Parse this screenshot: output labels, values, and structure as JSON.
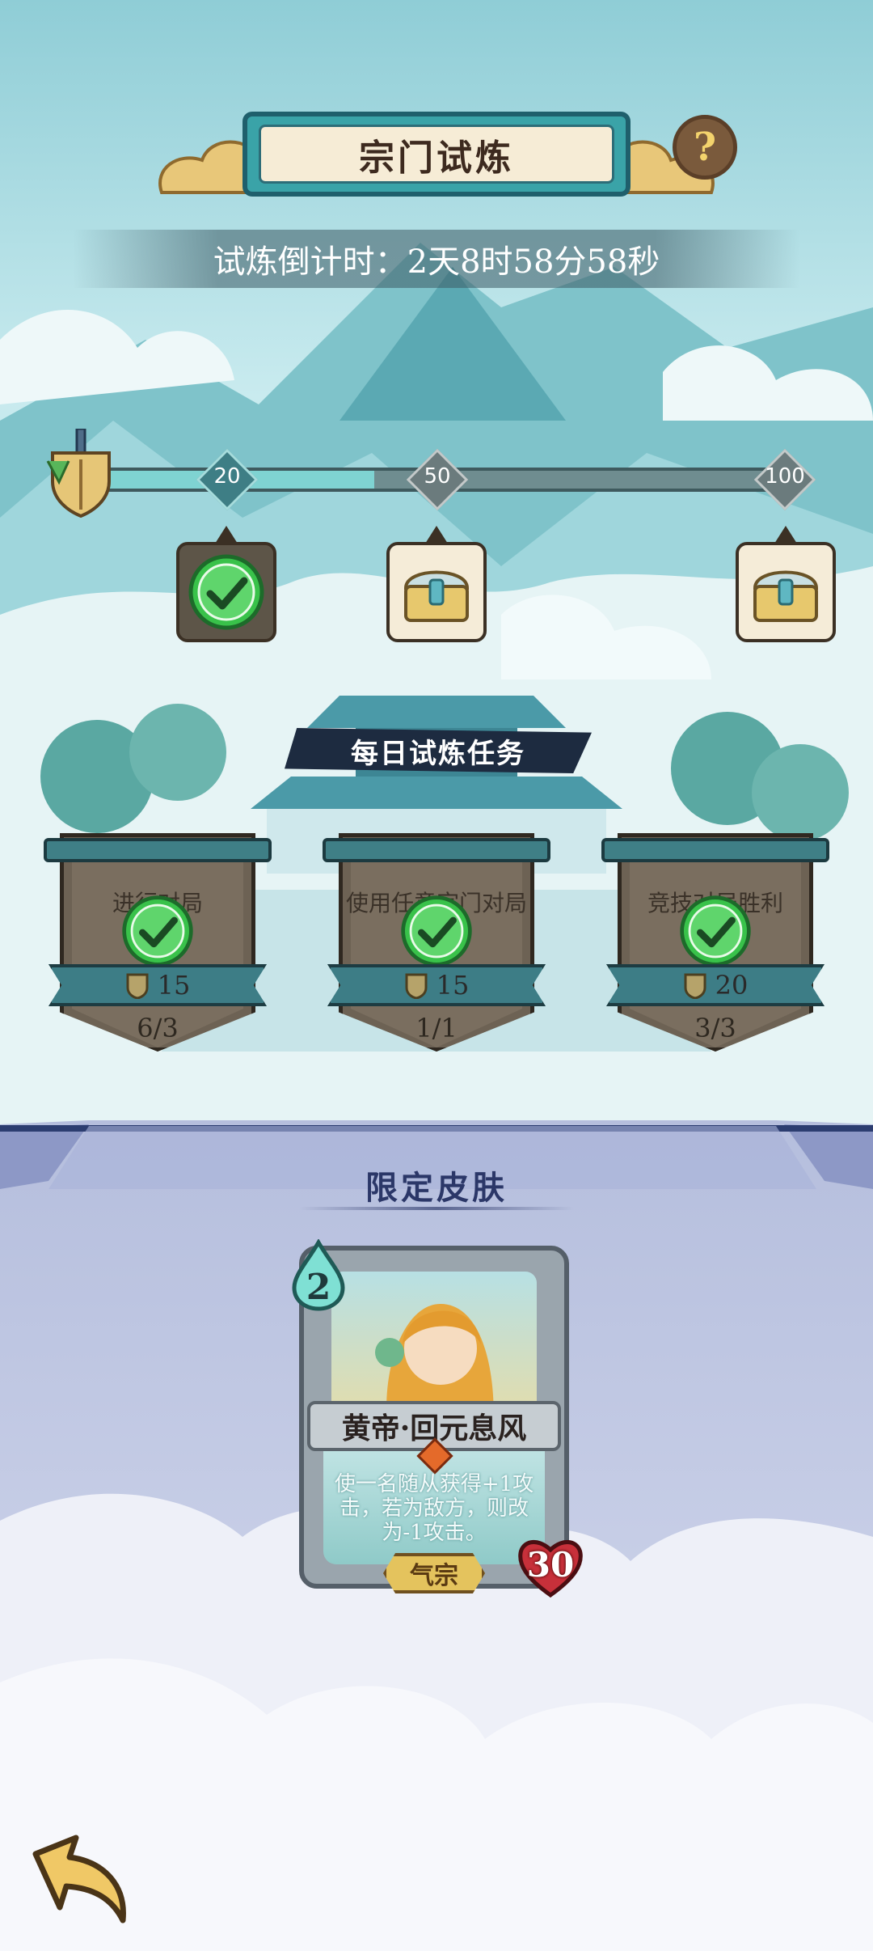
{
  "header": {
    "title": "宗门试炼",
    "help_label": "?",
    "countdown": "试炼倒计时：2天8时58分58秒"
  },
  "progress": {
    "current_fraction": 0.4,
    "milestones": [
      {
        "value": "20",
        "claimed": true
      },
      {
        "value": "50",
        "claimed": false
      },
      {
        "value": "100",
        "claimed": false
      }
    ]
  },
  "daily_tasks": {
    "title": "每日试炼任务",
    "items": [
      {
        "name": "进行对局",
        "points": "15",
        "progress": "6/3",
        "completed": true
      },
      {
        "name": "使用任意宗门对局获胜",
        "points": "15",
        "progress": "1/1",
        "completed": true
      },
      {
        "name": "竞技对局胜利",
        "points": "20",
        "progress": "3/3",
        "completed": true
      }
    ]
  },
  "limited_skin": {
    "title": "限定皮肤",
    "card": {
      "cost": "2",
      "name": "黄帝·回元息风",
      "description": "使一名随从获得+1攻击，若为敌方，则改为-1攻击。",
      "faction": "气宗",
      "attack": "30"
    }
  },
  "icons": {
    "help": "question-icon",
    "back": "back-arrow-icon",
    "reward": "treasure-chest-icon",
    "check": "check-icon",
    "shield": "shield-sword-icon"
  },
  "colors": {
    "accent": "#3aa3a8",
    "check_green": "#39c24a",
    "banner_dark": "#1d2b40"
  }
}
